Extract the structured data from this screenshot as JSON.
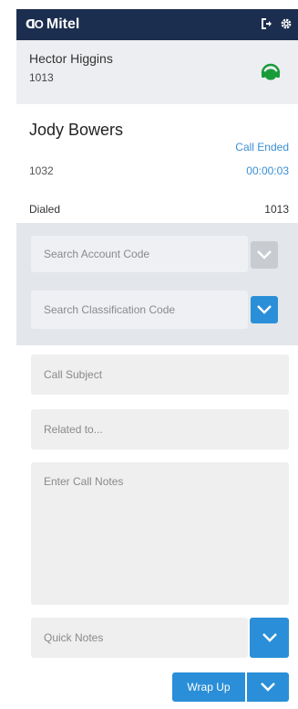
{
  "header": {
    "logo_glyph": "ᗡO",
    "brand": "Mitel",
    "logout_icon": "logout-icon",
    "settings_icon": "gear-icon"
  },
  "agent": {
    "name": "Hector Higgins",
    "extension": "1013",
    "status_icon": "headset-icon",
    "status_color": "#1a9b3a"
  },
  "call": {
    "contact_name": "Jody Bowers",
    "status": "Call Ended",
    "number": "1032",
    "duration": "00:00:03",
    "dialed_label": "Dialed",
    "dialed_number": "1013"
  },
  "form": {
    "account_code_placeholder": "Search Account Code",
    "classification_code_placeholder": "Search Classification Code",
    "call_subject_placeholder": "Call Subject",
    "related_to_placeholder": "Related to...",
    "call_notes_placeholder": "Enter Call Notes",
    "quick_notes_placeholder": "Quick Notes"
  },
  "actions": {
    "wrap_up_label": "Wrap Up"
  },
  "colors": {
    "header_bg": "#1c2e4f",
    "accent_blue": "#2a8fd8",
    "link_blue": "#3a8fd4",
    "panel_grey": "#e3e6ea"
  }
}
